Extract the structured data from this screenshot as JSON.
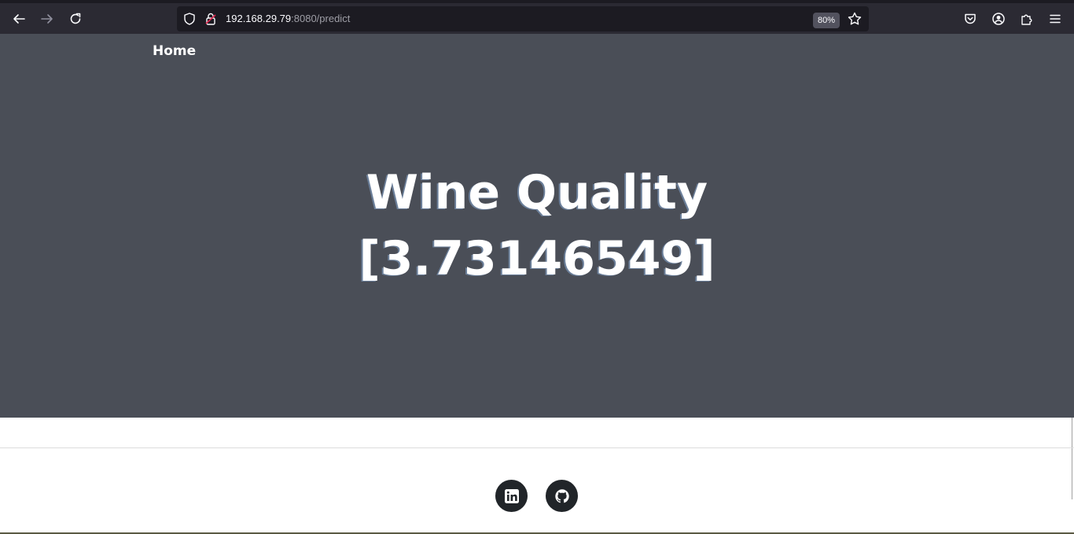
{
  "browser": {
    "url_host": "192.168.29.79",
    "url_rest": ":8080/predict",
    "zoom": "80%"
  },
  "nav": {
    "home_label": "Home"
  },
  "hero": {
    "title_line1": "Wine Quality",
    "title_line2": "[3.73146549]"
  },
  "footer": {
    "social_links": [
      "linkedin-icon",
      "github-icon"
    ]
  },
  "colors": {
    "hero_bg": "#4a4e57",
    "toolbar_bg": "#2b2a33",
    "social_bg": "#212529"
  }
}
